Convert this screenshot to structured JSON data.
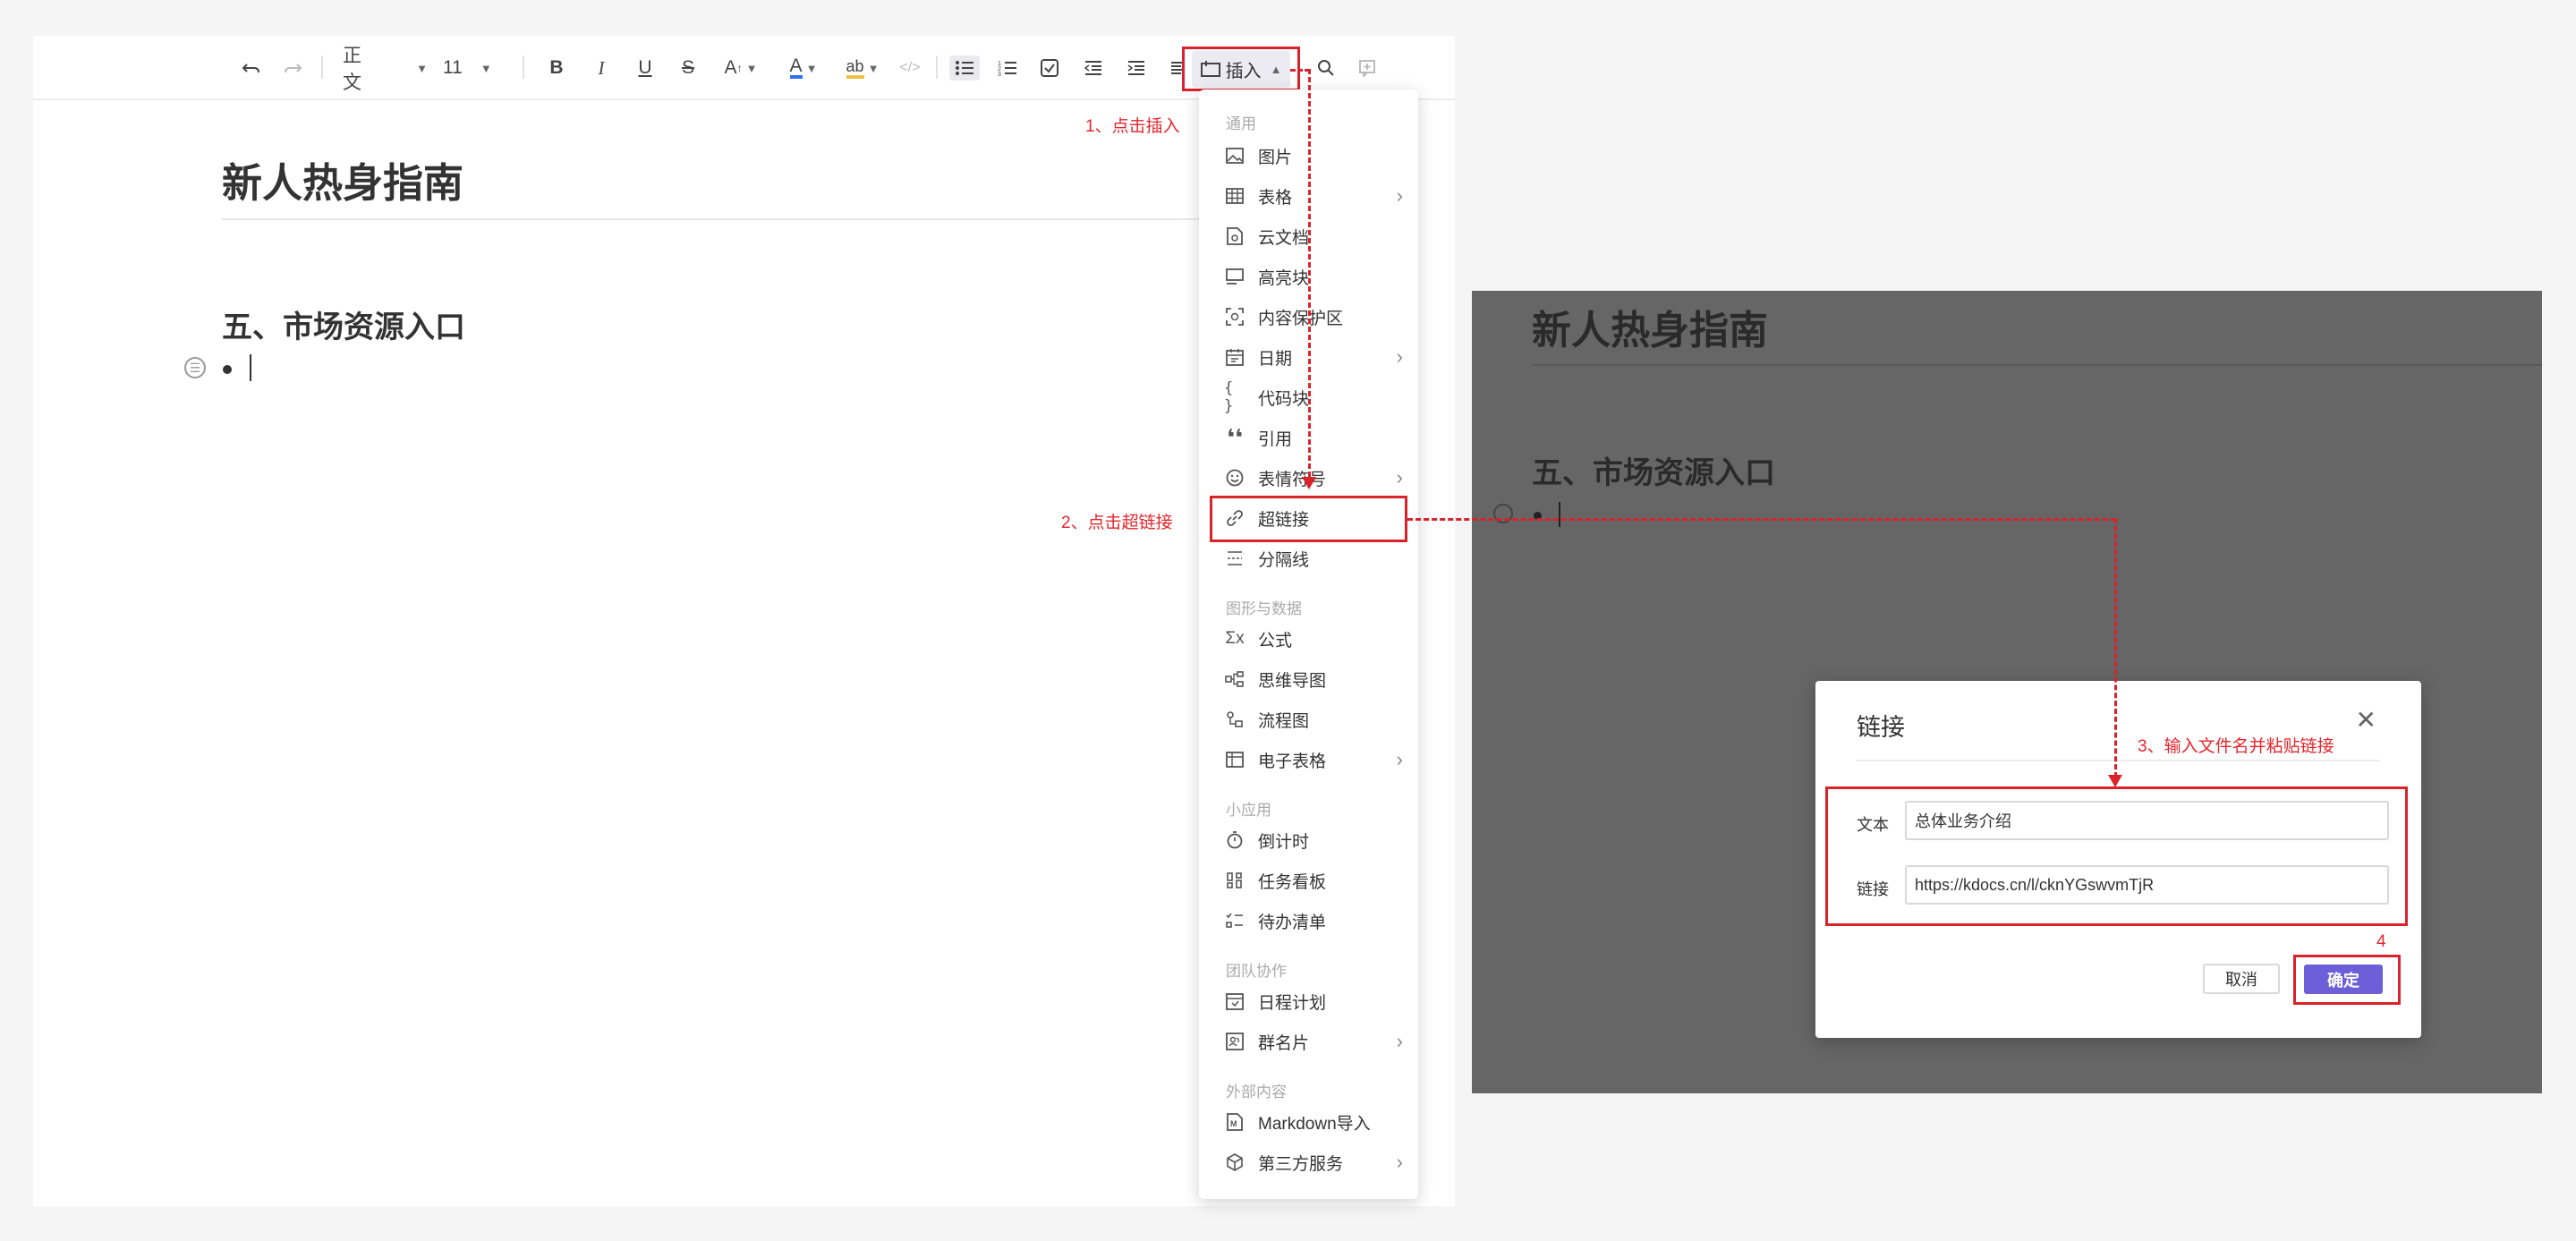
{
  "colors": {
    "accent": "#6c5fd8",
    "annotation_red": "#d9232b",
    "overlay": "#666666"
  },
  "toolbar": {
    "style_select": "正文",
    "font_size": "11",
    "insert_label": "插入"
  },
  "editor": {
    "title": "新人热身指南",
    "heading": "五、市场资源入口"
  },
  "annotations": {
    "step1": "1、点击插入",
    "step2": "2、点击超链接",
    "step3": "3、输入文件名并粘贴链接",
    "step4": "4"
  },
  "menu": {
    "groups": {
      "general": "通用",
      "graphics": "图形与数据",
      "apps": "小应用",
      "team": "团队协作",
      "external": "外部内容"
    },
    "items": {
      "image": "图片",
      "table": "表格",
      "cloud_doc": "云文档",
      "highlight": "高亮块",
      "protect": "内容保护区",
      "date": "日期",
      "code": "代码块",
      "quote": "引用",
      "emoji": "表情符号",
      "link": "超链接",
      "divider": "分隔线",
      "formula": "公式",
      "mindmap": "思维导图",
      "flowchart": "流程图",
      "spreadsheet": "电子表格",
      "countdown": "倒计时",
      "task_board": "任务看板",
      "todo": "待办清单",
      "schedule": "日程计划",
      "group_card": "群名片",
      "markdown": "Markdown导入",
      "third_party": "第三方服务"
    }
  },
  "dialog": {
    "title": "链接",
    "text_label": "文本",
    "text_value": "总体业务介绍",
    "link_label": "链接",
    "link_value": "https://kdocs.cn/l/cknYGswvmTjR",
    "cancel": "取消",
    "confirm": "确定"
  }
}
